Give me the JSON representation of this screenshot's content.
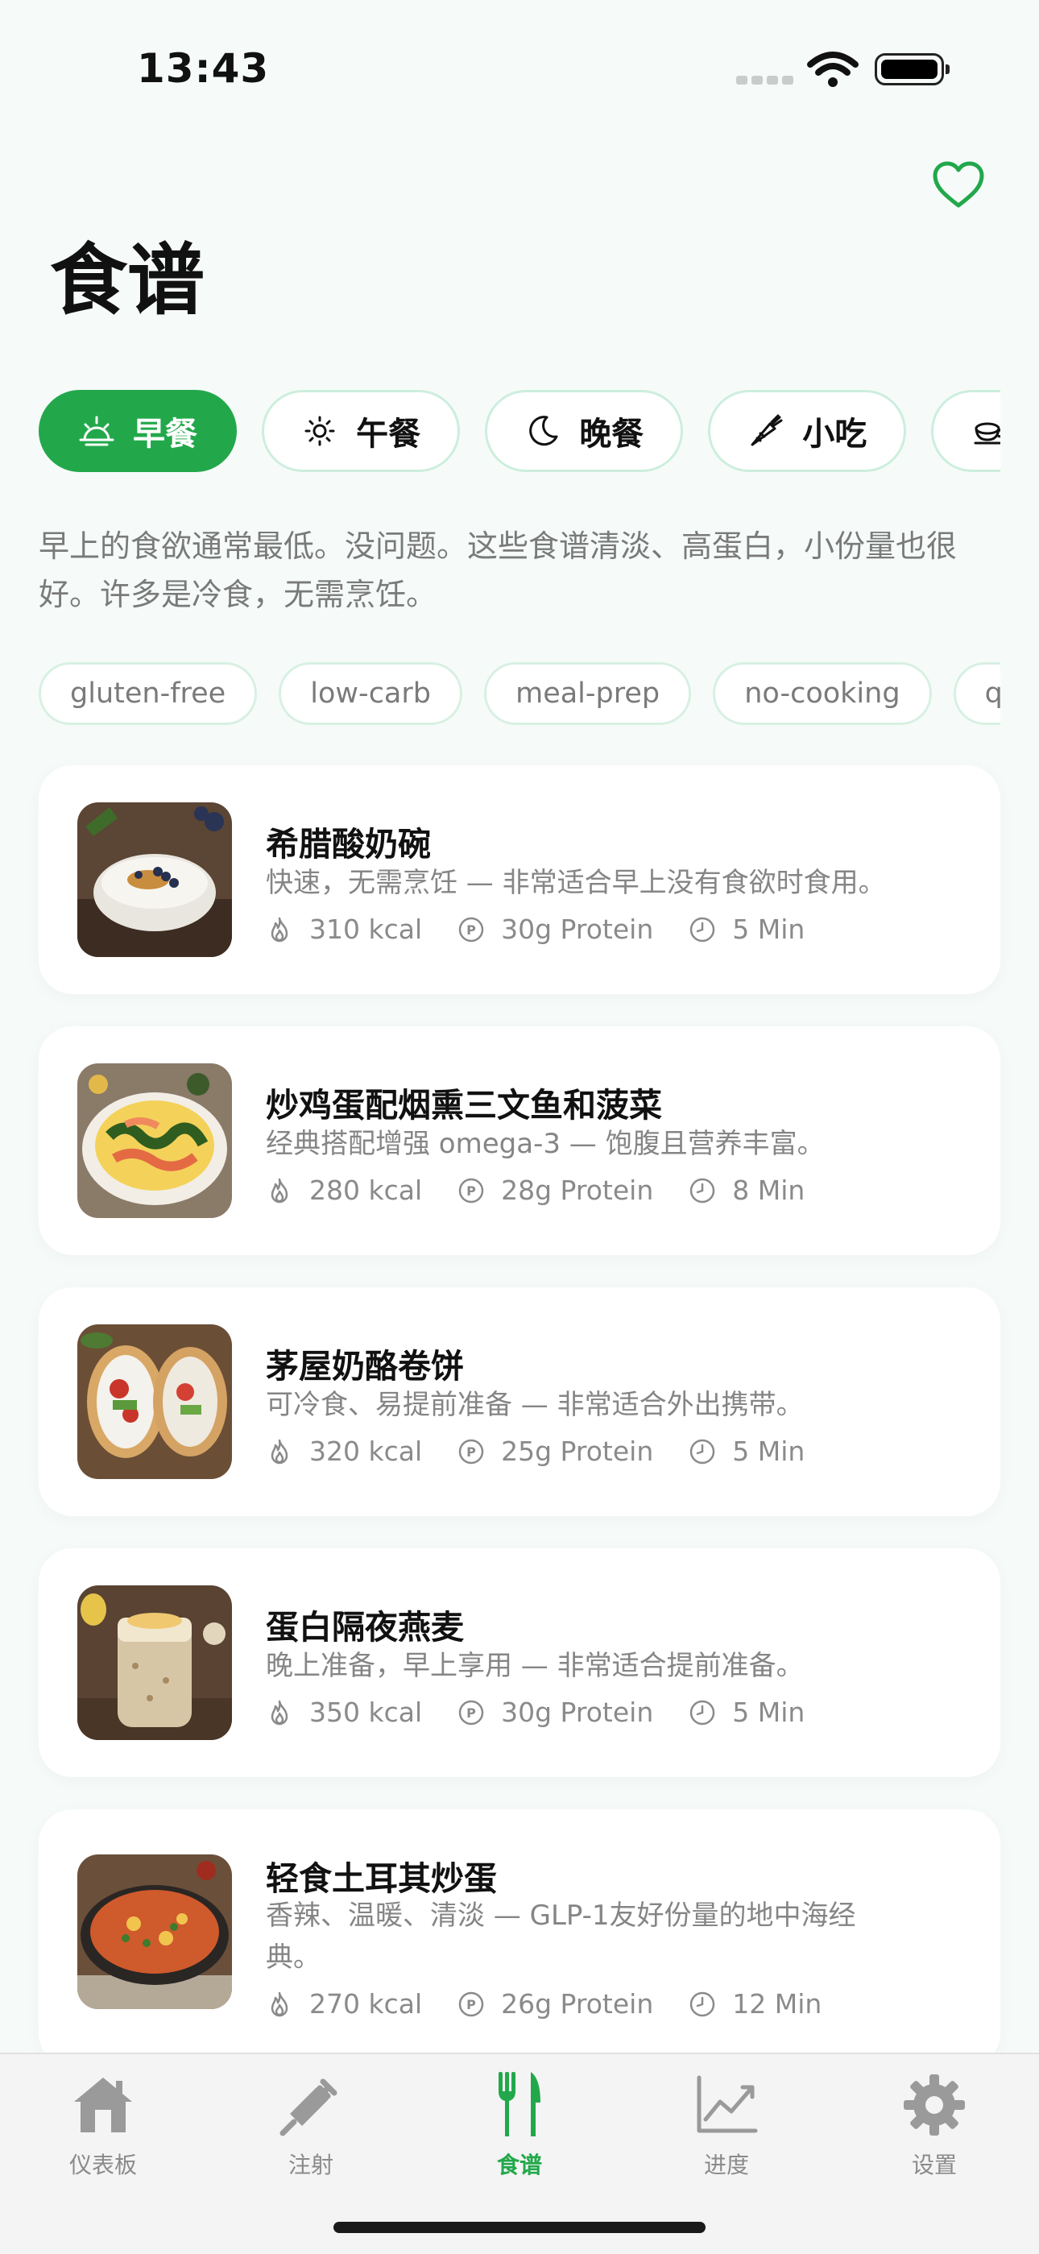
{
  "status_bar": {
    "time": "13:43"
  },
  "page": {
    "title": "食谱"
  },
  "meal_tabs": [
    {
      "label": "早餐",
      "icon": "sunrise-icon",
      "active": true
    },
    {
      "label": "午餐",
      "icon": "sun-icon",
      "active": false
    },
    {
      "label": "晚餐",
      "icon": "moon-icon",
      "active": false
    },
    {
      "label": "小吃",
      "icon": "carrot-icon",
      "active": false
    },
    {
      "label": "",
      "icon": "cup-icon",
      "active": false
    }
  ],
  "intro": "早上的食欲通常最低。没问题。这些食谱清淡、高蛋白，小份量也很好。许多是冷食，无需烹饪。",
  "tags": [
    "gluten-free",
    "low-carb",
    "meal-prep",
    "no-cooking",
    "qu"
  ],
  "recipes": [
    {
      "title": "希腊酸奶碗",
      "description": "快速，无需烹饪 — 非常适合早上没有食欲时食用。",
      "kcal": "310 kcal",
      "protein": "30g Protein",
      "time": "5 Min"
    },
    {
      "title": "炒鸡蛋配烟熏三文鱼和菠菜",
      "description": "经典搭配增强 omega-3 — 饱腹且营养丰富。",
      "kcal": "280 kcal",
      "protein": "28g Protein",
      "time": "8 Min"
    },
    {
      "title": "茅屋奶酪卷饼",
      "description": "可冷食、易提前准备 — 非常适合外出携带。",
      "kcal": "320 kcal",
      "protein": "25g Protein",
      "time": "5 Min"
    },
    {
      "title": "蛋白隔夜燕麦",
      "description": "晚上准备，早上享用 — 非常适合提前准备。",
      "kcal": "350 kcal",
      "protein": "30g Protein",
      "time": "5 Min"
    },
    {
      "title": "轻食土耳其炒蛋",
      "description": "香辣、温暖、清淡 — GLP-1友好份量的地中海经典。",
      "kcal": "270 kcal",
      "protein": "26g Protein",
      "time": "12 Min"
    }
  ],
  "tab_bar": [
    {
      "label": "仪表板",
      "icon": "home-icon",
      "active": false
    },
    {
      "label": "注射",
      "icon": "syringe-icon",
      "active": false
    },
    {
      "label": "食谱",
      "icon": "fork-knife-icon",
      "active": true
    },
    {
      "label": "进度",
      "icon": "chart-icon",
      "active": false
    },
    {
      "label": "设置",
      "icon": "gear-icon",
      "active": false
    }
  ],
  "colors": {
    "accent": "#22a84b",
    "background": "#f6fbf9",
    "muted_text": "#858585"
  }
}
